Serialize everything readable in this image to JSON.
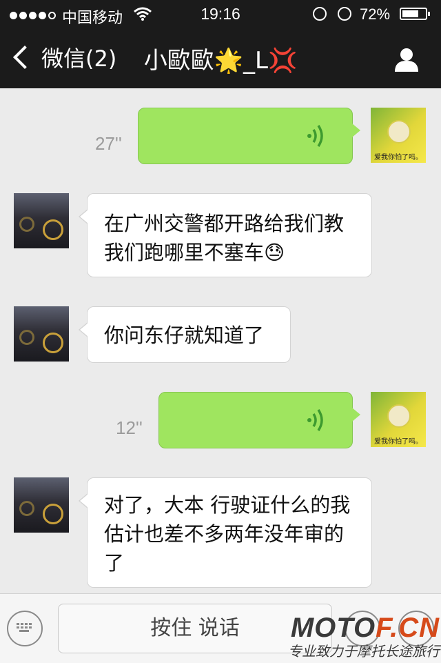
{
  "status_bar": {
    "carrier": "中国移动",
    "time": "19:16",
    "battery_percent": "72%",
    "battery_level": 0.72,
    "signal_bars": 4
  },
  "nav": {
    "back_label": "微信(2)",
    "title": "小歐歐🌟_L💢"
  },
  "messages": [
    {
      "side": "right",
      "type": "voice",
      "duration": "27''",
      "avatar_caption": "爱我你怕了吗。"
    },
    {
      "side": "left",
      "type": "text",
      "text": "在广州交警都开路给我们教我们跑哪里不塞车😓"
    },
    {
      "side": "left",
      "type": "text",
      "text": "你问东仔就知道了"
    },
    {
      "side": "right",
      "type": "voice",
      "duration": "12''",
      "avatar_caption": "爱我你怕了吗。"
    },
    {
      "side": "left",
      "type": "text",
      "text": "对了，大本 行驶证什么的我估计也差不多两年没年审的了"
    }
  ],
  "input_bar": {
    "hold_to_talk": "按住 说话"
  },
  "watermark": {
    "logo_part1": "MOTO",
    "logo_part2": "F.CN",
    "slogan": "专业致力于摩托长途旅行"
  },
  "colors": {
    "nav_bg": "#1b1b1b",
    "chat_bg": "#ebebeb",
    "voice_bubble": "#9fe55f",
    "text_bubble": "#ffffff"
  }
}
